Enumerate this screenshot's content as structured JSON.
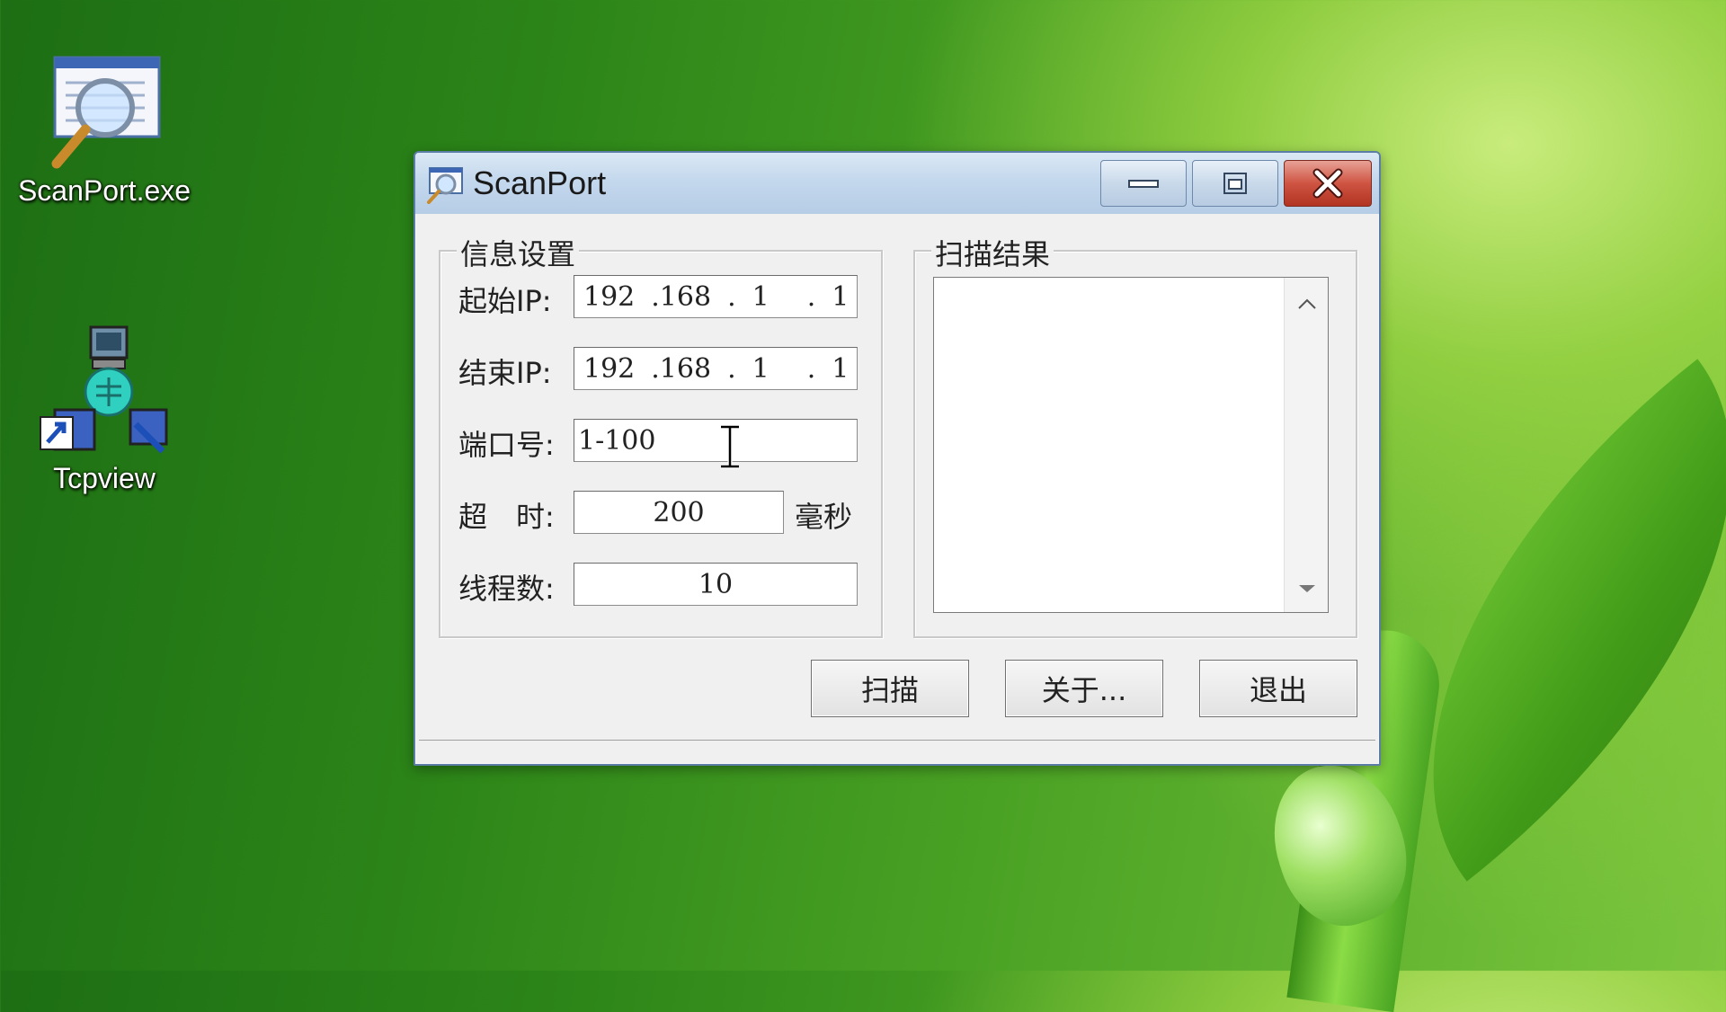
{
  "desktop": {
    "icons": [
      {
        "label": "ScanPort.exe",
        "icon": "magnifier-window-icon"
      },
      {
        "label": "Tcpview",
        "icon": "network-shortcut-icon"
      }
    ]
  },
  "window": {
    "title": "ScanPort",
    "settings_group": {
      "title": "信息设置",
      "start_ip_label": "起始IP:",
      "start_ip": [
        "192",
        ".168",
        ".",
        "1",
        ".",
        "1"
      ],
      "end_ip_label": "结束IP:",
      "end_ip": [
        "192",
        ".168",
        ".",
        "1",
        ".",
        "1"
      ],
      "port_label": "端口号:",
      "port_value": "1-100",
      "timeout_label": "超　时:",
      "timeout_value": "200",
      "timeout_unit": "毫秒",
      "threads_label": "线程数:",
      "threads_value": "10"
    },
    "results_group": {
      "title": "扫描结果"
    },
    "buttons": {
      "scan": "扫描",
      "about": "关于...",
      "exit": "退出"
    }
  },
  "colors": {
    "titlebar": "#c4d8ed",
    "close_button": "#cf5442"
  }
}
